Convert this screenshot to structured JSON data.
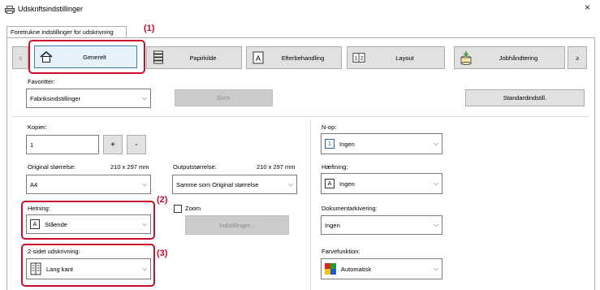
{
  "window": {
    "title": "Udskriftsindstillinger",
    "close_label": "×"
  },
  "tab": {
    "label": "Foretrukne indstillinger for udskrivning"
  },
  "callouts": {
    "c1": "(1)",
    "c2": "(2)",
    "c3": "(3)"
  },
  "nav": {
    "prev_label": "≤",
    "next_label": "≥",
    "items": [
      {
        "label": "Generelt",
        "icon": "home-icon"
      },
      {
        "label": "Papirkilde",
        "icon": "paper-tray-icon"
      },
      {
        "label": "Efterbehandling",
        "icon": "finishing-icon"
      },
      {
        "label": "Layout",
        "icon": "layout-icon"
      },
      {
        "label": "Jobhåndtering",
        "icon": "job-handling-icon"
      }
    ]
  },
  "favorites": {
    "label": "Favoritter:",
    "value": "Fabriksindstillinger",
    "save_label": "Gem",
    "default_label": "Standardindstill."
  },
  "copies": {
    "label": "Kopier:",
    "value": "1",
    "plus": "+",
    "minus": "-"
  },
  "original_size": {
    "label": "Original størrelse:",
    "dims": "210 x 297 mm",
    "value": "A4"
  },
  "output_size": {
    "label": "Outputstørrelse:",
    "dims": "210 x 297 mm",
    "value": "Samme som Original størrelse"
  },
  "orientation": {
    "label": "Hetning:",
    "value": "Stående",
    "icon_text": "A"
  },
  "zoom": {
    "label": "Zoom",
    "settings_label": "Indstillinger..."
  },
  "duplex": {
    "label": "2-sidet udskrivning:",
    "value": "Lang kant"
  },
  "nup": {
    "label": "N-op:",
    "value": "Ingen",
    "icon_text": "1"
  },
  "staple": {
    "label": "Hæftning:",
    "value": "Ingen",
    "icon_text": "A"
  },
  "document_filing": {
    "label": "Dokumentarkivering:",
    "value": "Ingen"
  },
  "color_mode": {
    "label": "Farvefunktion:",
    "value": "Automatisk"
  },
  "colors": {
    "highlight": "#c8102e",
    "callout": "#c00b2f",
    "button_bg": "#e1e1e1"
  }
}
